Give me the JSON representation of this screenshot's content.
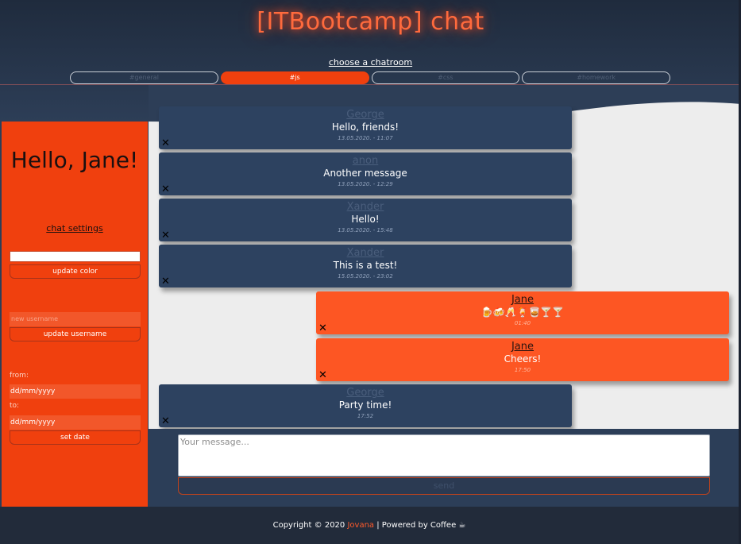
{
  "header": {
    "brand": "[ITBootcamp] chat",
    "choose_label": "choose a chatroom",
    "rooms": [
      {
        "label": "#general"
      },
      {
        "label": "#js"
      },
      {
        "label": "#css"
      },
      {
        "label": "#homework"
      }
    ],
    "active_room": "#js"
  },
  "sidebar": {
    "greeting": "Hello, Jane!",
    "settings_link": "chat settings",
    "color_input_value": "",
    "update_color_label": "update color",
    "username_placeholder": "new username",
    "update_username_label": "update username",
    "from_label": "from:",
    "to_label": "to:",
    "date_from_value": "dd/mm/yyyy",
    "date_to_value": "dd/mm/yyyy",
    "set_date_label": "set date"
  },
  "messages": [
    {
      "author": "George",
      "text": "Hello, friends!",
      "time": "13.05.2020. - 11:07",
      "mine": false,
      "delete_icon": "✕"
    },
    {
      "author": "anon",
      "text": "Another message",
      "time": "13.05.2020. - 12:29",
      "mine": false,
      "delete_icon": "✕"
    },
    {
      "author": "Xander",
      "text": "Hello!",
      "time": "13.05.2020. - 15:48",
      "mine": false,
      "delete_icon": "✕"
    },
    {
      "author": "Xander",
      "text": "This is a test!",
      "time": "15.05.2020. - 23:02",
      "mine": false,
      "delete_icon": "✕"
    },
    {
      "author": "Jane",
      "text": "🍺🍻🥂🍹🥃🍸🍸",
      "time": "01:40",
      "mine": true,
      "delete_icon": "✕"
    },
    {
      "author": "Jane",
      "text": "Cheers!",
      "time": "17:50",
      "mine": true,
      "delete_icon": "✕"
    },
    {
      "author": "George",
      "text": "Party time!",
      "time": "17:52",
      "mine": false,
      "delete_icon": "✕"
    }
  ],
  "composer": {
    "placeholder": "Your message...",
    "send_label": "send"
  },
  "footer": {
    "prefix": "Copyright © 2020 ",
    "author": "Jovana",
    "suffix": " | Powered by Coffee ☕"
  },
  "colors": {
    "accent": "#f0400e",
    "message_mine": "#fd5623",
    "message_other": "#2d4260",
    "header_bg": "#2d3e57",
    "footer_bg": "#222b3a"
  }
}
